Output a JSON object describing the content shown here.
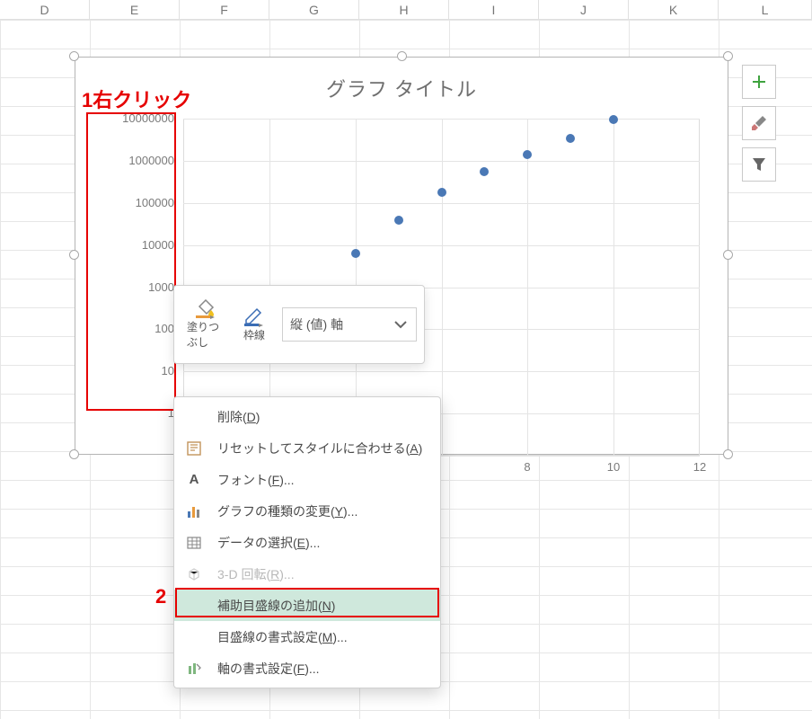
{
  "columns": [
    "D",
    "E",
    "F",
    "G",
    "H",
    "I",
    "J",
    "K",
    "L"
  ],
  "chart": {
    "title": "グラフ タイトル",
    "y_ticks": [
      "10000000",
      "1000000",
      "100000",
      "10000",
      "1000",
      "100",
      "10",
      "1"
    ],
    "x_ticks": [
      "8",
      "10",
      "12"
    ]
  },
  "annotations": {
    "label1": "1右クリック",
    "label2": "2"
  },
  "mini_toolbar": {
    "fill_label": "塗りつぶし",
    "outline_label": "枠線",
    "selector_value": "縦 (値) 軸"
  },
  "context_menu": {
    "items": [
      {
        "key": "delete",
        "label": "削除(",
        "accel": "D",
        "tail": ")"
      },
      {
        "key": "reset",
        "label": "リセットしてスタイルに合わせる(",
        "accel": "A",
        "tail": ")"
      },
      {
        "key": "font",
        "label": "フォント(",
        "accel": "F",
        "tail": ")..."
      },
      {
        "key": "chart-type",
        "label": "グラフの種類の変更(",
        "accel": "Y",
        "tail": ")..."
      },
      {
        "key": "select-data",
        "label": "データの選択(",
        "accel": "E",
        "tail": ")..."
      },
      {
        "key": "rotate3d",
        "label": "3-D 回転(",
        "accel": "R",
        "tail": ")..."
      },
      {
        "key": "add-minor-grid",
        "label": "補助目盛線の追加(",
        "accel": "N",
        "tail": ")"
      },
      {
        "key": "format-grid",
        "label": "目盛線の書式設定(",
        "accel": "M",
        "tail": ")..."
      },
      {
        "key": "format-axis",
        "label": "軸の書式設定(",
        "accel": "F",
        "tail": ")..."
      }
    ]
  },
  "chart_data": {
    "type": "scatter",
    "title": "グラフ タイトル",
    "x": [
      3.2,
      4,
      5,
      6,
      7,
      8,
      9,
      10
    ],
    "y": [
      2000,
      16000,
      80000,
      300000,
      800000,
      1800000,
      4000000,
      10000000
    ],
    "xlim": [
      0,
      12
    ],
    "ylim": [
      1,
      10000000
    ],
    "yscale": "log",
    "xlabel": "",
    "ylabel": ""
  }
}
